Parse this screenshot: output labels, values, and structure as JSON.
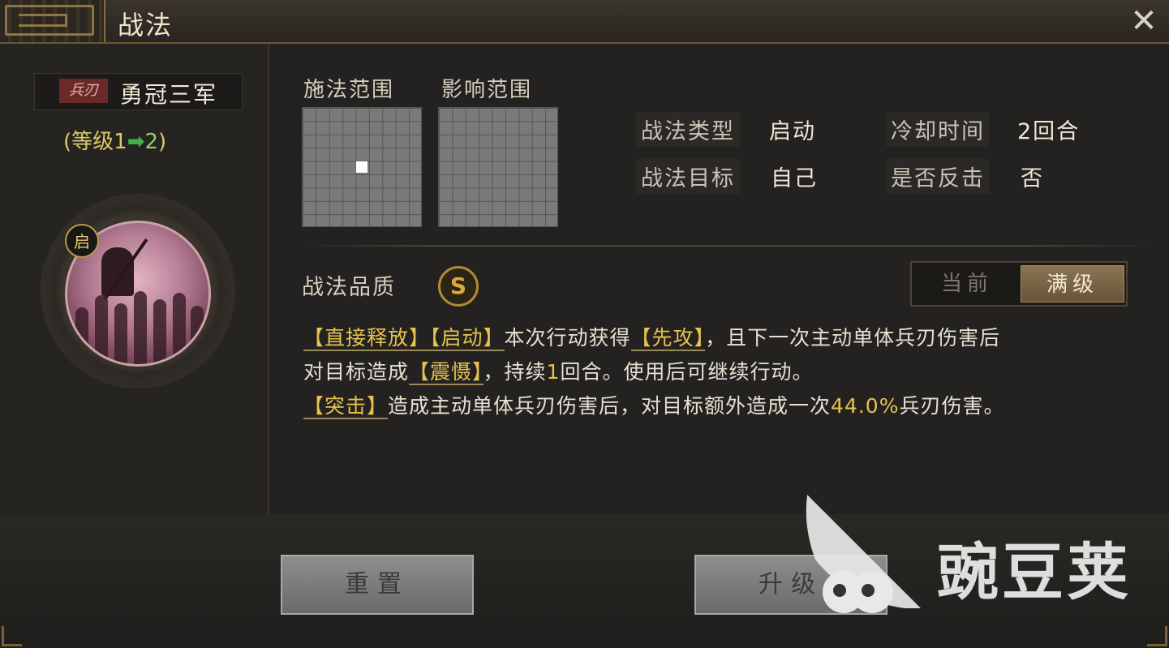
{
  "header": {
    "title": "战法",
    "close_symbol": "✕"
  },
  "skill": {
    "weapon_tag": "兵刃",
    "name": "勇冠三军",
    "level_open": "(等级1",
    "level_arrow": "➡",
    "level_to": "2",
    "level_close": ")",
    "type_badge": "启"
  },
  "ranges": {
    "cast_label": "施法范围",
    "effect_label": "影响范围"
  },
  "stats": {
    "type_label": "战法类型",
    "type_value": "启动",
    "cooldown_label": "冷却时间",
    "cooldown_value": "2回合",
    "target_label": "战法目标",
    "target_value": "自己",
    "counter_label": "是否反击",
    "counter_value": "否"
  },
  "quality": {
    "label": "战法品质",
    "value": "S"
  },
  "toggle": {
    "current": "当前",
    "full": "满级",
    "selected": "full"
  },
  "description": {
    "kw1": "【直接释放】",
    "kw2": "【启动】",
    "t1": "本次行动获得",
    "kw3": "【先攻】",
    "t2": "，且下一次主动单体兵刃伤害后",
    "t3": "对目标造成",
    "kw4": "【震慑】",
    "t4": "，持续",
    "n1": "1",
    "t5": "回合。使用后可继续行动。",
    "kw5": "【突击】",
    "t6": "造成主动单体兵刃伤害后，对目标额外造成一次",
    "n2": "44.0%",
    "t7": "兵刃伤害。"
  },
  "buttons": {
    "reset": "重置",
    "upgrade": "升级"
  },
  "watermark": {
    "text": "豌豆荚"
  },
  "colors": {
    "keyword": "#e7c24f",
    "weapon_tag_bg": "#6a2a2a",
    "level_arrow": "#3fb34a"
  }
}
